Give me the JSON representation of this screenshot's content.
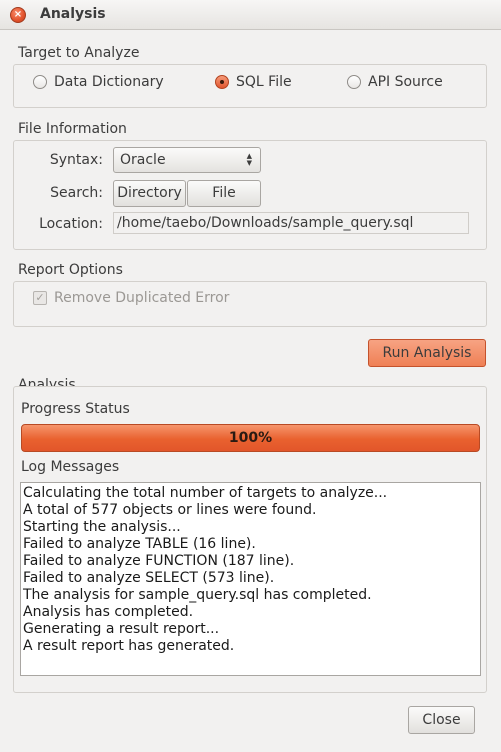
{
  "window": {
    "title": "Analysis"
  },
  "target": {
    "label": "Target to Analyze",
    "options": [
      {
        "label": "Data Dictionary",
        "selected": false
      },
      {
        "label": "SQL File",
        "selected": true
      },
      {
        "label": "API Source",
        "selected": false
      }
    ]
  },
  "file_info": {
    "label": "File Information",
    "syntax_label": "Syntax:",
    "syntax_value": "Oracle",
    "search_label": "Search:",
    "directory_button": "Directory",
    "file_button": "File",
    "location_label": "Location:",
    "location_value": "/home/taebo/Downloads/sample_query.sql"
  },
  "report_options": {
    "label": "Report Options",
    "remove_duplicated": {
      "label": "Remove Duplicated Error",
      "checked": true,
      "enabled": false
    }
  },
  "run_button": "Run Analysis",
  "analysis": {
    "label": "Analysis",
    "progress_label": "Progress Status",
    "progress_value": 1.0,
    "progress_text": "100%",
    "log_label": "Log Messages",
    "log": [
      "Calculating the total number of targets to analyze...",
      "A total of 577 objects or lines were found.",
      "Starting the analysis...",
      "Failed to analyze TABLE (16 line).",
      "Failed to analyze FUNCTION (187 line).",
      "Failed to analyze SELECT (573 line).",
      "The analysis for sample_query.sql has completed.",
      "Analysis has completed.",
      "Generating a result report...",
      "A result report has generated."
    ]
  },
  "close_button": "Close",
  "colors": {
    "accent": "#e9612f",
    "background": "#f2f1f0"
  }
}
